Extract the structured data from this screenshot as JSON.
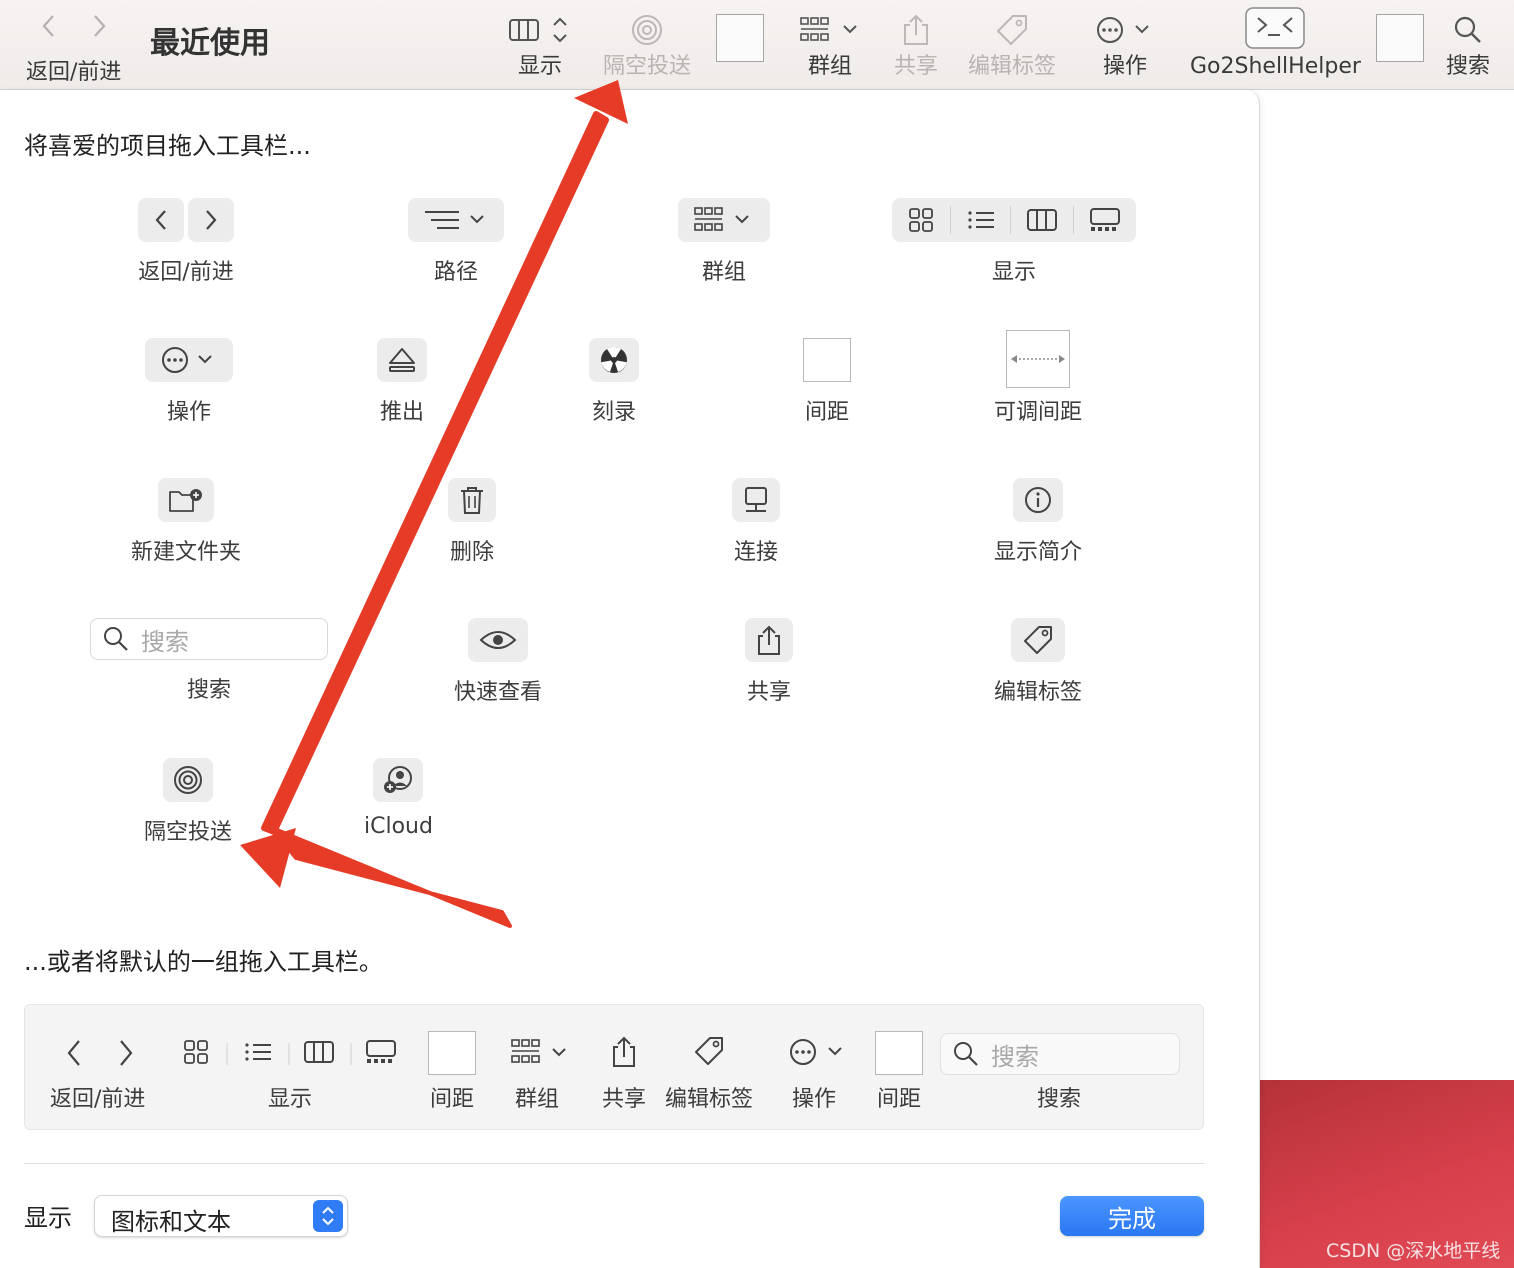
{
  "toolbar": {
    "title": "最近使用",
    "back_forward_label": "返回/前进",
    "view_label": "显示",
    "airdrop_label": "隔空投送",
    "group_label": "群组",
    "share_label": "共享",
    "tags_label": "编辑标签",
    "action_label": "操作",
    "go2shell_label": "Go2ShellHelper",
    "search_label": "搜索"
  },
  "sheet": {
    "drag_heading": "将喜爱的项目拖入工具栏...",
    "default_heading": "...或者将默认的一组拖入工具栏。",
    "items": {
      "back_forward": "返回/前进",
      "path": "路径",
      "group": "群组",
      "view": "显示",
      "action": "操作",
      "eject": "推出",
      "burn": "刻录",
      "space": "间距",
      "flexible_space": "可调间距",
      "new_folder": "新建文件夹",
      "delete": "删除",
      "connect": "连接",
      "get_info": "显示简介",
      "search": "搜索",
      "search_placeholder": "搜索",
      "quick_look": "快速查看",
      "share": "共享",
      "edit_tags": "编辑标签",
      "airdrop": "隔空投送",
      "icloud": "iCloud"
    },
    "default_set": {
      "back_forward": "返回/前进",
      "view": "显示",
      "space1": "间距",
      "group": "群组",
      "share": "共享",
      "edit_tags": "编辑标签",
      "action": "操作",
      "space2": "间距",
      "search": "搜索",
      "search_placeholder": "搜索"
    },
    "show_label": "显示",
    "show_value": "图标和文本",
    "done_label": "完成"
  },
  "watermark": "CSDN @深水地平线",
  "colors": {
    "accent": "#2a77f3",
    "annotation_arrow": "#e63b26"
  }
}
